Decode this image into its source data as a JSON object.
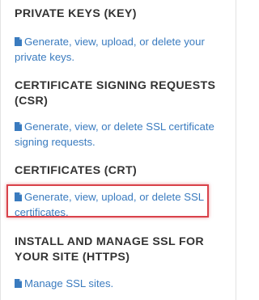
{
  "sections": [
    {
      "heading": "PRIVATE KEYS (KEY)",
      "link": "Generate, view, upload, or delete your private keys.",
      "icon": "document-icon"
    },
    {
      "heading": "CERTIFICATE SIGNING REQUESTS (CSR)",
      "link": "Generate, view, or delete SSL certificate signing requests.",
      "icon": "document-icon"
    },
    {
      "heading": "CERTIFICATES (CRT)",
      "link": "Generate, view, upload, or delete SSL certificates.",
      "icon": "document-icon",
      "highlighted": true
    },
    {
      "heading": "INSTALL AND MANAGE SSL FOR YOUR SITE (HTTPS)",
      "link": "Manage SSL sites.",
      "icon": "document-icon"
    }
  ],
  "colors": {
    "heading": "#333333",
    "link": "#3a7bbf",
    "highlight": "#d9424a"
  }
}
